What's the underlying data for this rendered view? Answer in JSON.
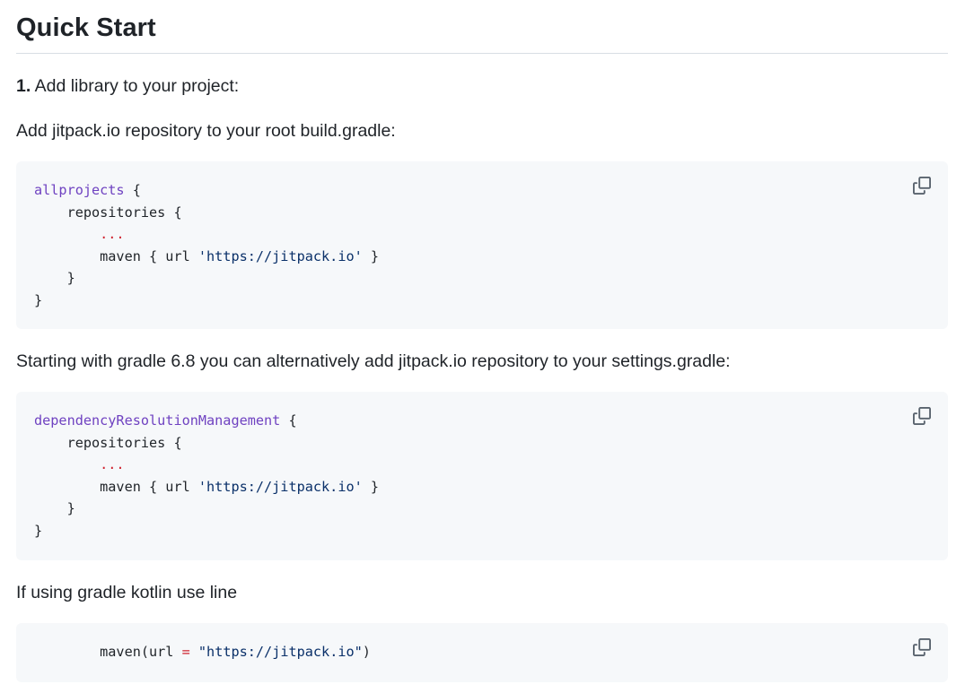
{
  "heading": "Quick Start",
  "step1": {
    "number": "1.",
    "text": " Add library to your project:"
  },
  "para_root": "Add jitpack.io repository to your root build.gradle:",
  "block1": {
    "l1_kw": "allprojects",
    "l1_rest": " {",
    "l2": "    repositories {",
    "l3_red": "        ...",
    "l4_pre": "        maven { url ",
    "l4_str": "'https://jitpack.io'",
    "l4_post": " }",
    "l5": "    }",
    "l6": "}"
  },
  "para_settings": "Starting with gradle 6.8 you can alternatively add jitpack.io repository to your settings.gradle:",
  "block2": {
    "l1_kw": "dependencyResolutionManagement",
    "l1_rest": " {",
    "l2": "    repositories {",
    "l3_red": "        ...",
    "l4_pre": "        maven { url ",
    "l4_str": "'https://jitpack.io'",
    "l4_post": " }",
    "l5": "    }",
    "l6": "}"
  },
  "para_kotlin": "If using gradle kotlin use line",
  "block3": {
    "l1_pre": "        maven(url ",
    "l1_op": "=",
    "l1_sp": " ",
    "l1_str": "\"https://jitpack.io\"",
    "l1_post": ")"
  },
  "icons": {
    "copy": "copy-icon"
  },
  "colors": {
    "keyword": "#6f42c1",
    "string": "#0a3069",
    "ellipsis": "#cf222e",
    "code_bg": "#f6f8fa",
    "text": "#1f2328",
    "icon": "#59636e"
  }
}
